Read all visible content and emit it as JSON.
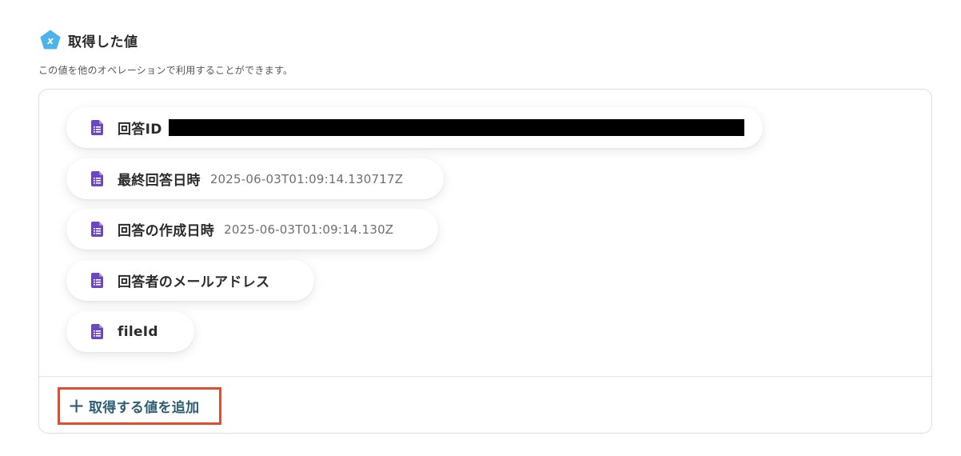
{
  "section": {
    "title": "取得した値",
    "description": "この値を他のオペレーションで利用することができます。",
    "icon": "variable-x-icon",
    "icon_color": "#4cb4e8"
  },
  "values": [
    {
      "label": "回答ID",
      "value": "",
      "redacted": true
    },
    {
      "label": "最終回答日時",
      "value": "2025-06-03T01:09:14.130717Z"
    },
    {
      "label": "回答の作成日時",
      "value": "2025-06-03T01:09:14.130Z"
    },
    {
      "label": "回答者のメールアドレス",
      "value": ""
    },
    {
      "label": "fileId",
      "value": ""
    }
  ],
  "item_icon": "google-forms-document-icon",
  "item_icon_color": "#6b47c2",
  "add_button": {
    "label": "取得する値を追加",
    "icon": "plus-icon",
    "color": "#2d5e74",
    "highlight_color": "#e34c2e"
  }
}
